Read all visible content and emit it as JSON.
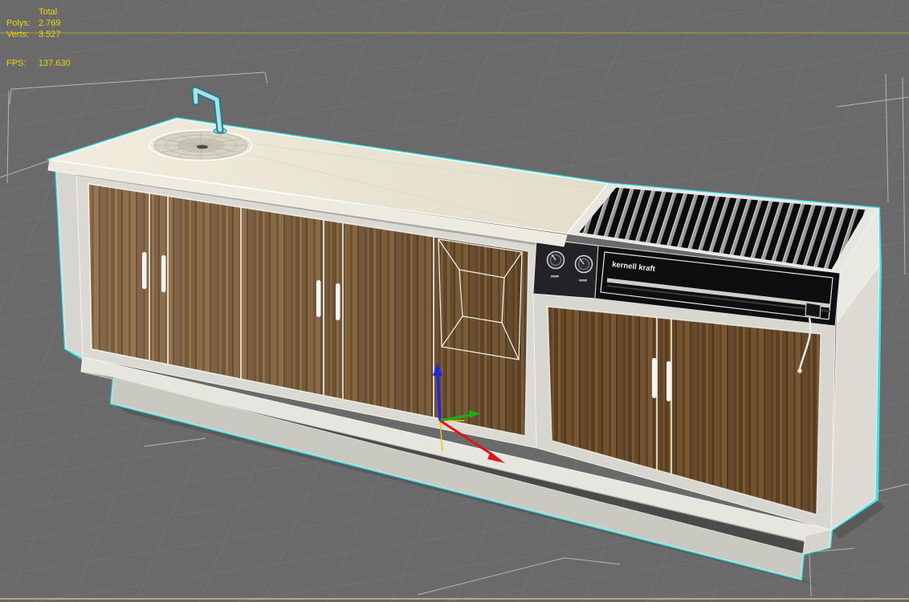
{
  "stats": {
    "header": "Total",
    "polys_label": "Polys:",
    "polys_value": "2.769",
    "verts_label": "Verts:",
    "verts_value": "3.527",
    "fps_label": "FPS:",
    "fps_value": "137.630"
  },
  "model": {
    "brand_label": "kernell kraft"
  },
  "colors": {
    "background": "#6a6a6a",
    "grid_line": "#7b7b7b",
    "grid_major_line": "#96923d",
    "selection_outline": "#38e2ea",
    "stats_text": "#e9d50c",
    "wireframe_edge": "#f2f2ee",
    "countertop": "#ece7d8",
    "cabinet_frame": "#dadad3",
    "wood_base": "#7b5a33",
    "grill_body": "#0e0e10",
    "faucet_selected": "#a8e2e6",
    "gizmo_x_axis": "#e61212",
    "gizmo_y_axis": "#17b017",
    "gizmo_z_axis": "#2224e6"
  }
}
